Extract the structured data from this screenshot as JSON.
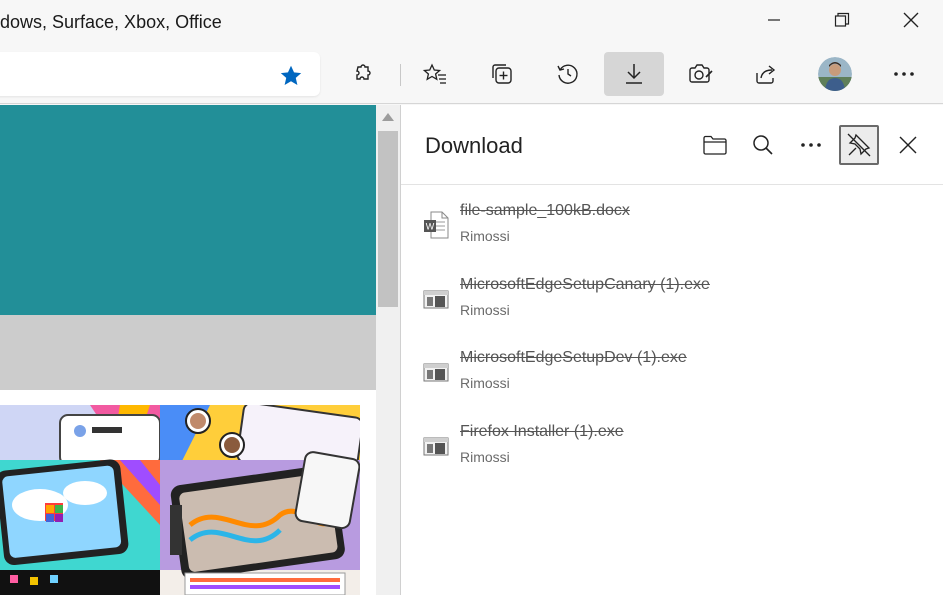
{
  "window": {
    "title": "dows, Surface, Xbox, Office",
    "controls": [
      "minimize-icon",
      "restore-icon",
      "close-icon"
    ]
  },
  "toolbar": {
    "buttons": [
      "extensions-icon",
      "favorites-icon",
      "collections-icon",
      "history-icon",
      "downloads-icon",
      "web-capture-icon",
      "share-icon",
      "profile-avatar",
      "more-icon"
    ],
    "active_button": "downloads-icon",
    "accent_color": "#0067c0"
  },
  "page": {
    "banner_color": "#228f98"
  },
  "downloads_panel": {
    "title": "Download",
    "header_buttons": [
      "open-folder-icon",
      "search-icon",
      "more-options-icon",
      "unpin-icon",
      "close-icon"
    ],
    "items": [
      {
        "name": "file-sample_100kB.docx",
        "status": "Rimossi",
        "type": "word-document-icon"
      },
      {
        "name": "MicrosoftEdgeSetupCanary (1).exe",
        "status": "Rimossi",
        "type": "executable-icon"
      },
      {
        "name": "MicrosoftEdgeSetupDev (1).exe",
        "status": "Rimossi",
        "type": "executable-icon"
      },
      {
        "name": "Firefox Installer (1).exe",
        "status": "Rimossi",
        "type": "executable-icon"
      }
    ]
  }
}
